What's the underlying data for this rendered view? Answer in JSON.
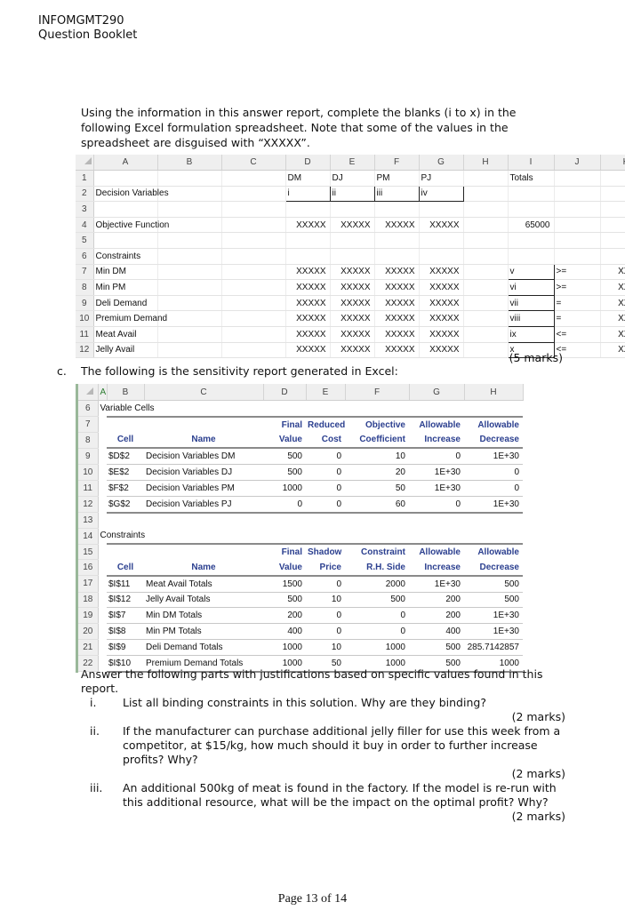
{
  "header": {
    "course": "INFOMGMT290",
    "booklet": "Question Booklet"
  },
  "intro": "Using the information in this answer report, complete the blanks (i to x) in the following Excel formulation spreadsheet. Note that some of the values in the spreadsheet are disguised with “XXXXX”.",
  "sheet1": {
    "columns": [
      "A",
      "B",
      "C",
      "D",
      "E",
      "F",
      "G",
      "H",
      "I",
      "J",
      "K"
    ],
    "var_headers": [
      "DM",
      "DJ",
      "PM",
      "PJ"
    ],
    "totals_label": "Totals",
    "decision_label": "Decision Variables",
    "blanks_vars": [
      "i",
      "ii",
      "iii",
      "iv"
    ],
    "objective_label": "Objective Function",
    "objective_coeffs": [
      "XXXXX",
      "XXXXX",
      "XXXXX",
      "XXXXX"
    ],
    "objective_total": "65000",
    "constraints_label": "Constraints",
    "constraints": [
      {
        "row": "7",
        "name": "Min DM",
        "coeffs": [
          "XXXXX",
          "XXXXX",
          "XXXXX",
          "XXXXX"
        ],
        "total": "v",
        "sign": ">=",
        "rhs": "XXXXX"
      },
      {
        "row": "8",
        "name": "Min PM",
        "coeffs": [
          "XXXXX",
          "XXXXX",
          "XXXXX",
          "XXXXX"
        ],
        "total": "vi",
        "sign": ">=",
        "rhs": "XXXXX"
      },
      {
        "row": "9",
        "name": "Deli Demand",
        "coeffs": [
          "XXXXX",
          "XXXXX",
          "XXXXX",
          "XXXXX"
        ],
        "total": "vii",
        "sign": "=",
        "rhs": "XXXXX"
      },
      {
        "row": "10",
        "name": "Premium Demand",
        "coeffs": [
          "XXXXX",
          "XXXXX",
          "XXXXX",
          "XXXXX"
        ],
        "total": "viii",
        "sign": "=",
        "rhs": "XXXXX"
      },
      {
        "row": "11",
        "name": "Meat Avail",
        "coeffs": [
          "XXXXX",
          "XXXXX",
          "XXXXX",
          "XXXXX"
        ],
        "total": "ix",
        "sign": "<=",
        "rhs": "XXXXX"
      },
      {
        "row": "12",
        "name": "Jelly Avail",
        "coeffs": [
          "XXXXX",
          "XXXXX",
          "XXXXX",
          "XXXXX"
        ],
        "total": "x",
        "sign": "<=",
        "rhs": "XXXXX"
      }
    ],
    "marks": "(5 marks)"
  },
  "partc": {
    "label": "c.",
    "text": "The following is the sensitivity report generated in Excel:"
  },
  "sheet2": {
    "columns": [
      "A",
      "B",
      "C",
      "D",
      "E",
      "F",
      "G",
      "H"
    ],
    "variable_section": "Variable Cells",
    "var_head1": [
      "",
      "",
      "Final",
      "Reduced",
      "Objective",
      "Allowable",
      "Allowable"
    ],
    "var_head2": [
      "Cell",
      "Name",
      "Value",
      "Cost",
      "Coefficient",
      "Increase",
      "Decrease"
    ],
    "variables": [
      {
        "row": "9",
        "cell": "$D$2",
        "name": "Decision Variables DM",
        "final": "500",
        "reduced": "0",
        "coef": "10",
        "inc": "0",
        "dec": "1E+30"
      },
      {
        "row": "10",
        "cell": "$E$2",
        "name": "Decision Variables DJ",
        "final": "500",
        "reduced": "0",
        "coef": "20",
        "inc": "1E+30",
        "dec": "0"
      },
      {
        "row": "11",
        "cell": "$F$2",
        "name": "Decision Variables PM",
        "final": "1000",
        "reduced": "0",
        "coef": "50",
        "inc": "1E+30",
        "dec": "0"
      },
      {
        "row": "12",
        "cell": "$G$2",
        "name": "Decision Variables PJ",
        "final": "0",
        "reduced": "0",
        "coef": "60",
        "inc": "0",
        "dec": "1E+30"
      }
    ],
    "constraint_section": "Constraints",
    "con_head1": [
      "",
      "",
      "Final",
      "Shadow",
      "Constraint",
      "Allowable",
      "Allowable"
    ],
    "con_head2": [
      "Cell",
      "Name",
      "Value",
      "Price",
      "R.H. Side",
      "Increase",
      "Decrease"
    ],
    "constraints": [
      {
        "row": "17",
        "cell": "$I$11",
        "name": "Meat Avail Totals",
        "final": "1500",
        "shadow": "0",
        "rhs": "2000",
        "inc": "1E+30",
        "dec": "500"
      },
      {
        "row": "18",
        "cell": "$I$12",
        "name": "Jelly Avail Totals",
        "final": "500",
        "shadow": "10",
        "rhs": "500",
        "inc": "200",
        "dec": "500"
      },
      {
        "row": "19",
        "cell": "$I$7",
        "name": "Min DM Totals",
        "final": "200",
        "shadow": "0",
        "rhs": "0",
        "inc": "200",
        "dec": "1E+30"
      },
      {
        "row": "20",
        "cell": "$I$8",
        "name": "Min PM Totals",
        "final": "400",
        "shadow": "0",
        "rhs": "0",
        "inc": "400",
        "dec": "1E+30"
      },
      {
        "row": "21",
        "cell": "$I$9",
        "name": "Deli Demand Totals",
        "final": "1000",
        "shadow": "10",
        "rhs": "1000",
        "inc": "500",
        "dec": "285.7142857"
      },
      {
        "row": "22",
        "cell": "$I$10",
        "name": "Premium Demand Totals",
        "final": "1000",
        "shadow": "50",
        "rhs": "1000",
        "inc": "500",
        "dec": "1000"
      }
    ]
  },
  "questions": {
    "intro": "Answer the following parts with justifications based on specific values found in this report.",
    "items": [
      {
        "num": "i.",
        "text": "List all binding constraints in this solution. Why are they binding?",
        "marks": "(2 marks)"
      },
      {
        "num": "ii.",
        "text": "If the manufacturer can purchase additional jelly filler for use this week from a competitor, at $15/kg, how much should it buy in order to further increase profits? Why?",
        "marks": "(2 marks)"
      },
      {
        "num": "iii.",
        "text": "An additional 500kg of meat is found in the factory. If the model is re-run with this additional resource, what will be the impact on the optimal profit? Why?",
        "marks": "(2 marks)"
      }
    ]
  },
  "footer": "Page 13 of 14"
}
